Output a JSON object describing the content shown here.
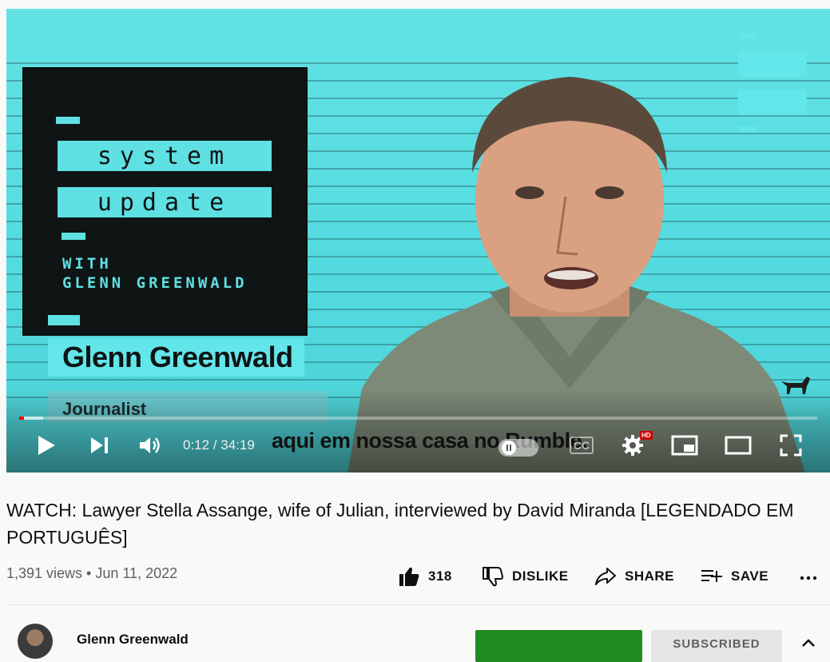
{
  "player": {
    "show_logo": {
      "word1": "system",
      "word2": "update",
      "sub": "WITH\nGLENN GREENWALD"
    },
    "lower_third": {
      "name": "Glenn Greenwald",
      "role": "Journalist"
    },
    "caption": "aqui em nossa casa no Rumble.",
    "time_display": "0:12 / 34:19",
    "progress_fraction": 0.006,
    "buffer_fraction": 0.03,
    "controls": {
      "play": "play-icon",
      "next": "next-icon",
      "volume": "volume-icon",
      "autoplay": "autoplay-toggle-icon",
      "subtitles": "CC",
      "settings": "gear-icon",
      "settings_badge": "HD",
      "miniplayer": "miniplayer-icon",
      "theater": "theater-mode-icon",
      "fullscreen": "fullscreen-icon"
    },
    "brand_colors": {
      "progress": "#ff0000",
      "background": "#54dbdf"
    }
  },
  "video": {
    "title": "WATCH: Lawyer Stella Assange, wife of Julian, interviewed by David Miranda [LEGENDADO EM PORTUGUÊS]",
    "meta": "1,391 views • Jun 11, 2022"
  },
  "actions": {
    "like_count": "318",
    "dislike": "DISLIKE",
    "share": "SHARE",
    "save": "SAVE",
    "more": "more-icon"
  },
  "channel": {
    "name": "Glenn Greenwald",
    "subscribe_label": "SUBSCRIBED"
  }
}
